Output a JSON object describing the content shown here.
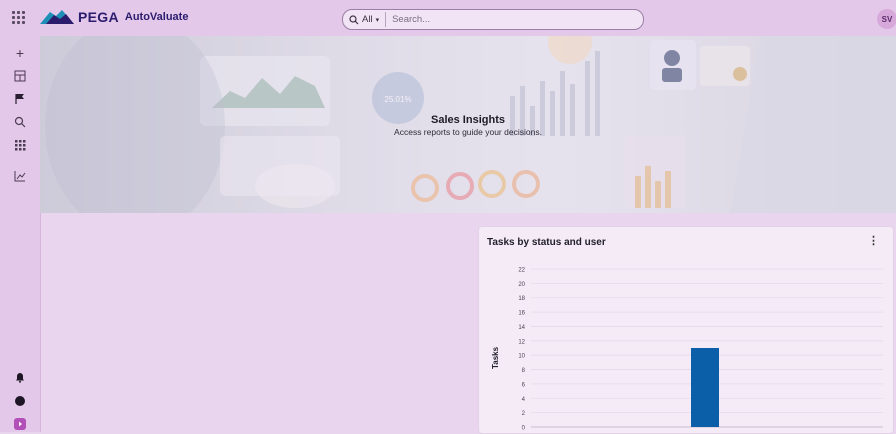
{
  "header": {
    "brand": "PEGA",
    "app_name": "AutoValuate",
    "search": {
      "scope": "All",
      "placeholder": "Search..."
    },
    "user_initials": "SV"
  },
  "sidebar": {
    "top_items": [
      "add-icon",
      "dashboard-icon",
      "flag-icon",
      "search-icon",
      "apps-icon",
      "chart-icon"
    ],
    "bottom_items": [
      "notification-icon",
      "help-icon",
      "expand-icon"
    ]
  },
  "hero": {
    "title": "Sales Insights",
    "subtitle": "Access reports to guide your decisions."
  },
  "card": {
    "title": "Tasks by status and user",
    "menu_icon": "more-vertical-icon"
  },
  "colors": {
    "bar": "#0b5ea8",
    "accent": "#2b1c6e"
  },
  "chart_data": {
    "type": "bar",
    "title": "Tasks by status and user",
    "ylabel": "Tasks",
    "xlabel": "",
    "ylim": [
      0,
      22
    ],
    "yticks": [
      0,
      2,
      4,
      6,
      8,
      10,
      12,
      14,
      16,
      18,
      20,
      22
    ],
    "series": [
      {
        "values": [
          11
        ]
      }
    ],
    "grid": true
  }
}
